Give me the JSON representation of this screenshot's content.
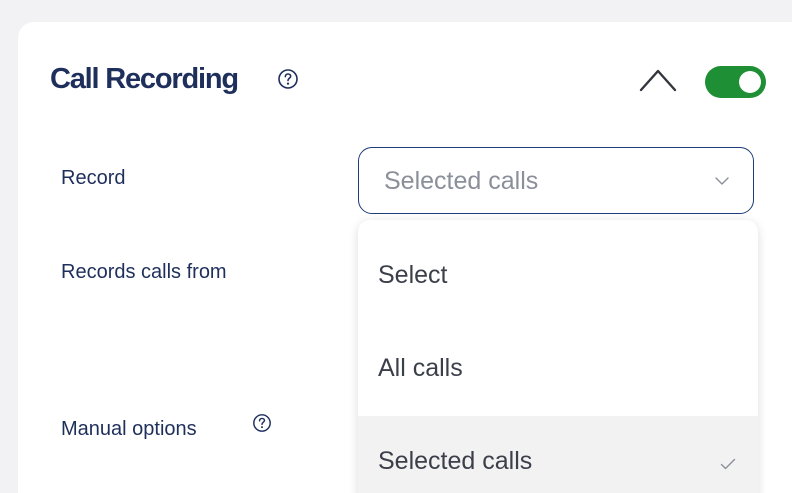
{
  "section": {
    "title": "Call Recording",
    "enabled": true
  },
  "colors": {
    "title_text": "#1f2f5c",
    "toggle_on": "#1e8f34",
    "select_border": "#1f3d7a",
    "selected_option_bg": "#f2f2f2"
  },
  "icons": {
    "help": "question-circle-icon",
    "collapse": "chevron-up-icon",
    "select_arrow": "chevron-down-icon",
    "selected_mark": "checkmark-icon"
  },
  "fields": {
    "record_label": "Record",
    "records_from_label": "Records calls from",
    "manual_options_label": "Manual options"
  },
  "record_select": {
    "value": "Selected calls",
    "options": [
      {
        "label": "Select",
        "selected": false
      },
      {
        "label": "All calls",
        "selected": false
      },
      {
        "label": "Selected calls",
        "selected": true
      }
    ]
  }
}
